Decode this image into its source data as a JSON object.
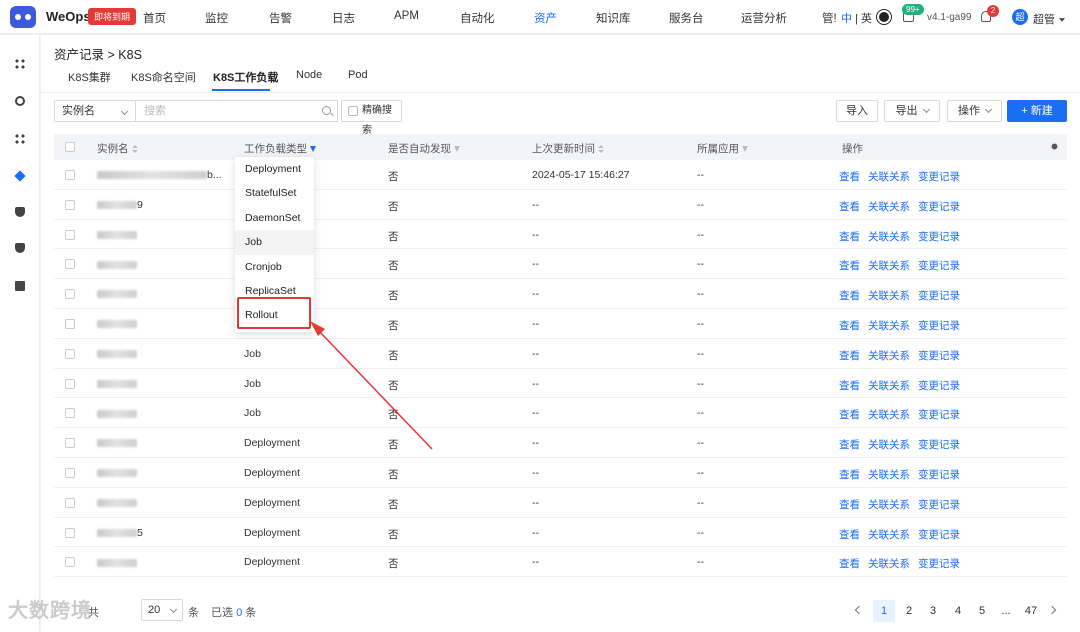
{
  "header": {
    "app_name": "WeOps",
    "promo_badge": "即将到期",
    "nav": [
      "首页",
      "监控",
      "告警",
      "日志",
      "APM",
      "自动化",
      "资产",
      "知识库",
      "服务台",
      "运营分析",
      "管!"
    ],
    "active_nav": "资产",
    "lang_zh": "中",
    "lang_sep": "|",
    "lang_en": "英",
    "msg_count": "99+",
    "version": "v4.1-ga99",
    "bell_count": "2",
    "avatar_initial": "超",
    "user_name": "超管"
  },
  "sidebar": {
    "icons": [
      "grid-icon",
      "satellite-icon",
      "grid-icon",
      "layers-icon",
      "shield-icon",
      "shield-icon",
      "bookmark-icon"
    ]
  },
  "breadcrumb": {
    "parent": "资产记录",
    "sep": ">",
    "current": "K8S"
  },
  "tabs": [
    "K8S集群",
    "K8S命名空间",
    "K8S工作负载",
    "Node",
    "Pod"
  ],
  "active_tab": "K8S工作负载",
  "toolbar": {
    "field_select": "实例名",
    "search_placeholder": "搜索",
    "exact_label": "精确搜索",
    "import_label": "导入",
    "export_label": "导出",
    "ops_label": "操作",
    "new_label": "+ 新建"
  },
  "table": {
    "headers": {
      "name": "实例名",
      "type": "工作负载类型",
      "auto": "是否自动发现",
      "updated": "上次更新时间",
      "app": "所属应用",
      "actions": "操作"
    },
    "action_labels": [
      "查看",
      "关联关系",
      "变更记录"
    ],
    "rows": [
      {
        "name_suffix": "b...",
        "type": "",
        "auto": "否",
        "updated": "2024-05-17 15:46:27",
        "app": "--"
      },
      {
        "name_suffix": "9",
        "type": "",
        "auto": "否",
        "updated": "--",
        "app": "--"
      },
      {
        "name_suffix": "",
        "type": "",
        "auto": "否",
        "updated": "--",
        "app": "--"
      },
      {
        "name_suffix": "",
        "type": "",
        "auto": "否",
        "updated": "--",
        "app": "--"
      },
      {
        "name_suffix": "",
        "type": "",
        "auto": "否",
        "updated": "--",
        "app": "--"
      },
      {
        "name_suffix": "",
        "type": "",
        "auto": "否",
        "updated": "--",
        "app": "--"
      },
      {
        "name_suffix": "",
        "type": "Job",
        "auto": "否",
        "updated": "--",
        "app": "--"
      },
      {
        "name_suffix": "",
        "type": "Job",
        "auto": "否",
        "updated": "--",
        "app": "--"
      },
      {
        "name_suffix": "",
        "type": "Job",
        "auto": "否",
        "updated": "--",
        "app": "--"
      },
      {
        "name_suffix": "",
        "type": "Deployment",
        "auto": "否",
        "updated": "--",
        "app": "--"
      },
      {
        "name_suffix": "",
        "type": "Deployment",
        "auto": "否",
        "updated": "--",
        "app": "--"
      },
      {
        "name_suffix": "",
        "type": "Deployment",
        "auto": "否",
        "updated": "--",
        "app": "--"
      },
      {
        "name_suffix": "5",
        "type": "Deployment",
        "auto": "否",
        "updated": "--",
        "app": "--"
      },
      {
        "name_suffix": "",
        "type": "Deployment",
        "auto": "否",
        "updated": "--",
        "app": "--"
      }
    ]
  },
  "type_filter": {
    "options": [
      "Deployment",
      "StatefulSet",
      "DaemonSet",
      "Job",
      "Cronjob",
      "ReplicaSet",
      "Rollout"
    ],
    "hovered": "Job",
    "highlighted": "Rollout"
  },
  "footer": {
    "total_prefix": "共",
    "page_size": "20",
    "per_page_unit": "条",
    "selected_prefix": "已选",
    "selected_count": "0",
    "selected_unit": "条",
    "pages": [
      "1",
      "2",
      "3",
      "4",
      "5",
      "...",
      "47"
    ],
    "current_page": "1"
  },
  "watermark": "大数跨境",
  "colors": {
    "primary": "#1a6ef5",
    "danger": "#e53935",
    "success": "#22b07d"
  }
}
